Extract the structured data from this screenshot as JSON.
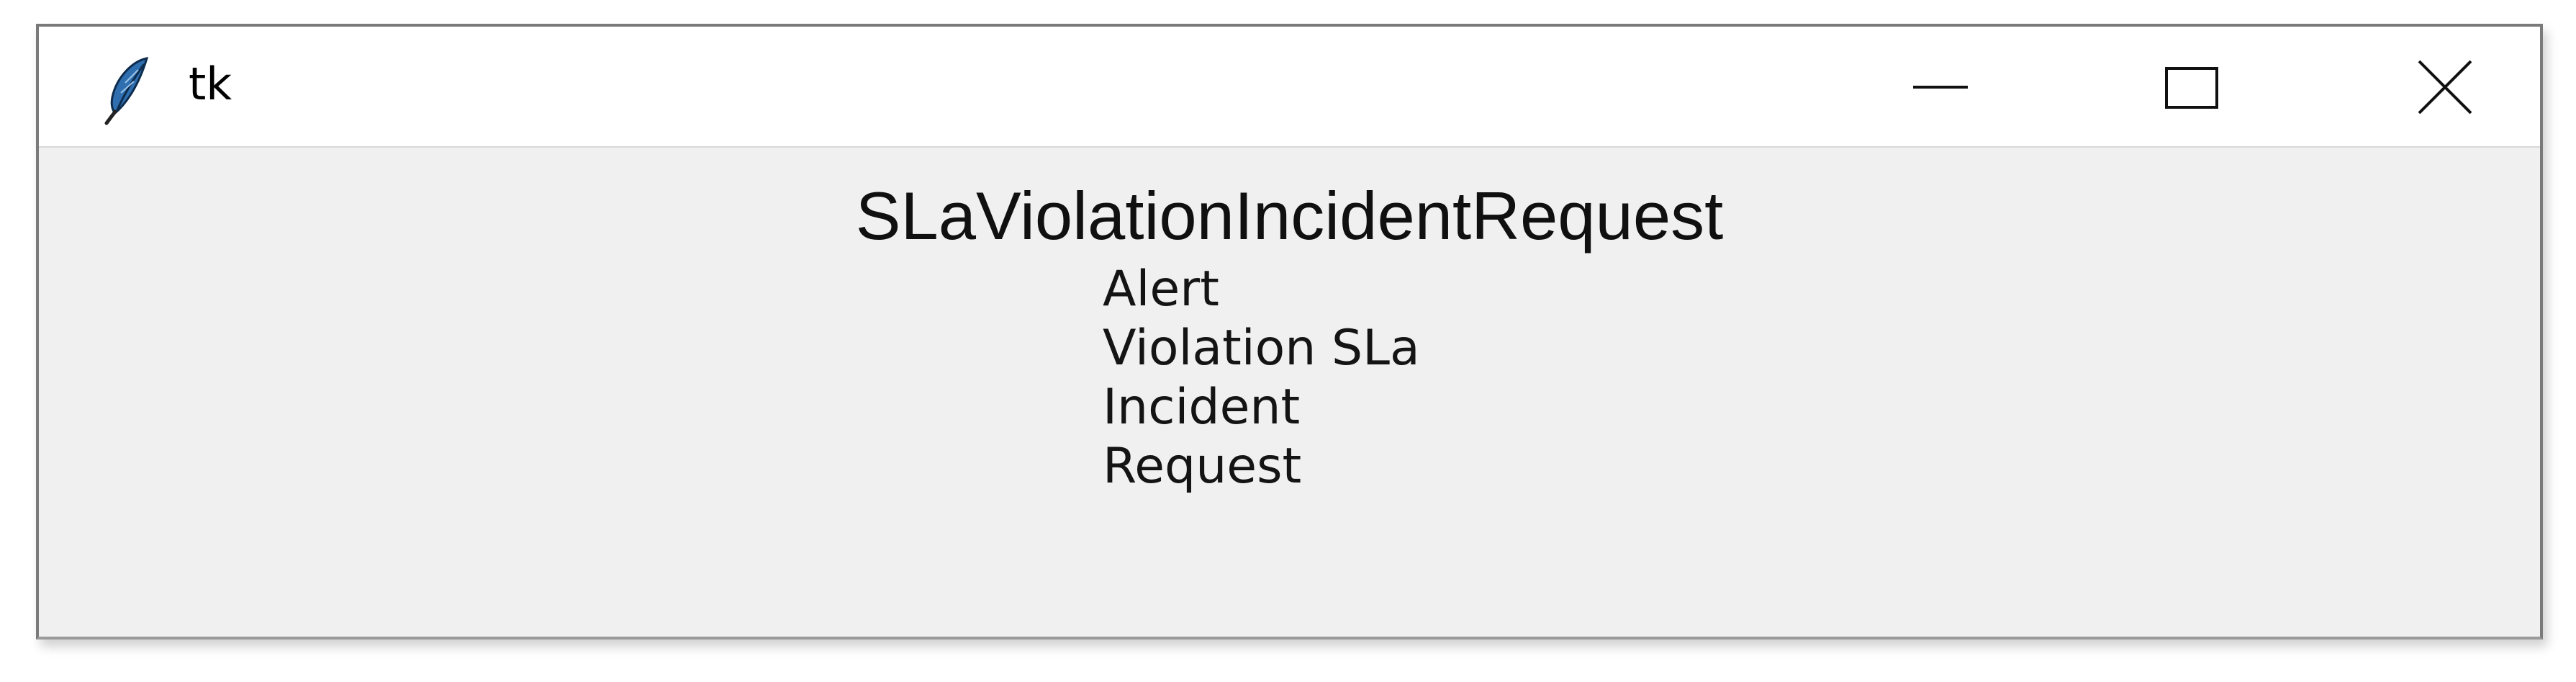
{
  "window": {
    "title": "tk",
    "icon": "tk-feather-icon",
    "controls": {
      "minimize_icon": "minimize-icon",
      "maximize_icon": "maximize-icon",
      "close_icon": "close-icon"
    }
  },
  "content": {
    "heading": "SLaViolationIncidentRequest",
    "items": [
      "Alert",
      "Violation SLa",
      "Incident",
      "Request"
    ]
  },
  "colors": {
    "titlebar_bg": "#ffffff",
    "client_bg": "#f0f0f0",
    "text": "#141414",
    "border": "#7a7a7a"
  }
}
